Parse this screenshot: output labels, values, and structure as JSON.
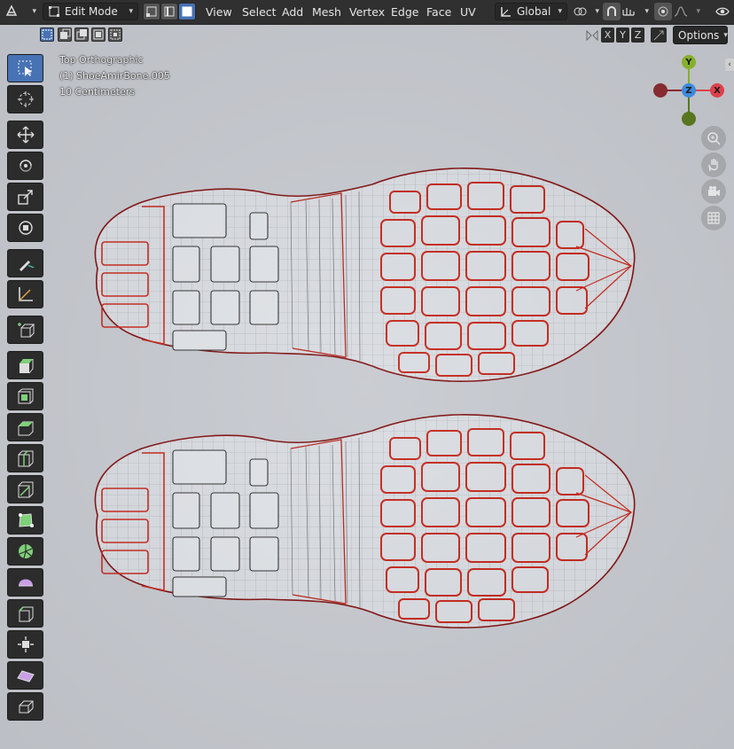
{
  "header": {
    "mode": "Edit Mode",
    "menus": [
      "View",
      "Select",
      "Add",
      "Mesh",
      "Vertex",
      "Edge",
      "Face",
      "UV"
    ],
    "transform_orientation": "Global"
  },
  "subheader": {
    "axes": [
      "X",
      "Y",
      "Z"
    ],
    "options_label": "Options"
  },
  "viewport": {
    "view_name": "Top Orthographic",
    "object_name": "(1) ShoeAmirBone.005",
    "scale": "10 Centimeters"
  },
  "gizmo": {
    "y_label": "Y",
    "z_label": "Z",
    "x_label": "X",
    "colors": {
      "x": "#e8424e",
      "y": "#8ab82c",
      "z": "#3f8ee6",
      "neg": "#a0323b"
    }
  },
  "toolbar": {
    "tools": [
      "select-box",
      "cursor",
      "move",
      "rotate",
      "scale",
      "transform",
      "annotate",
      "measure",
      "add-cube",
      "extrude",
      "inset",
      "bevel",
      "loop-cut",
      "knife",
      "poly-build",
      "spin",
      "smooth",
      "edge-slide",
      "shrink-fatten",
      "shear",
      "rip-region"
    ]
  },
  "colors": {
    "accent": "#4772b3",
    "viewport_bg": "#c6c9cf",
    "selected_edge": "#e02a1c",
    "wire": "#4a4a4a"
  }
}
